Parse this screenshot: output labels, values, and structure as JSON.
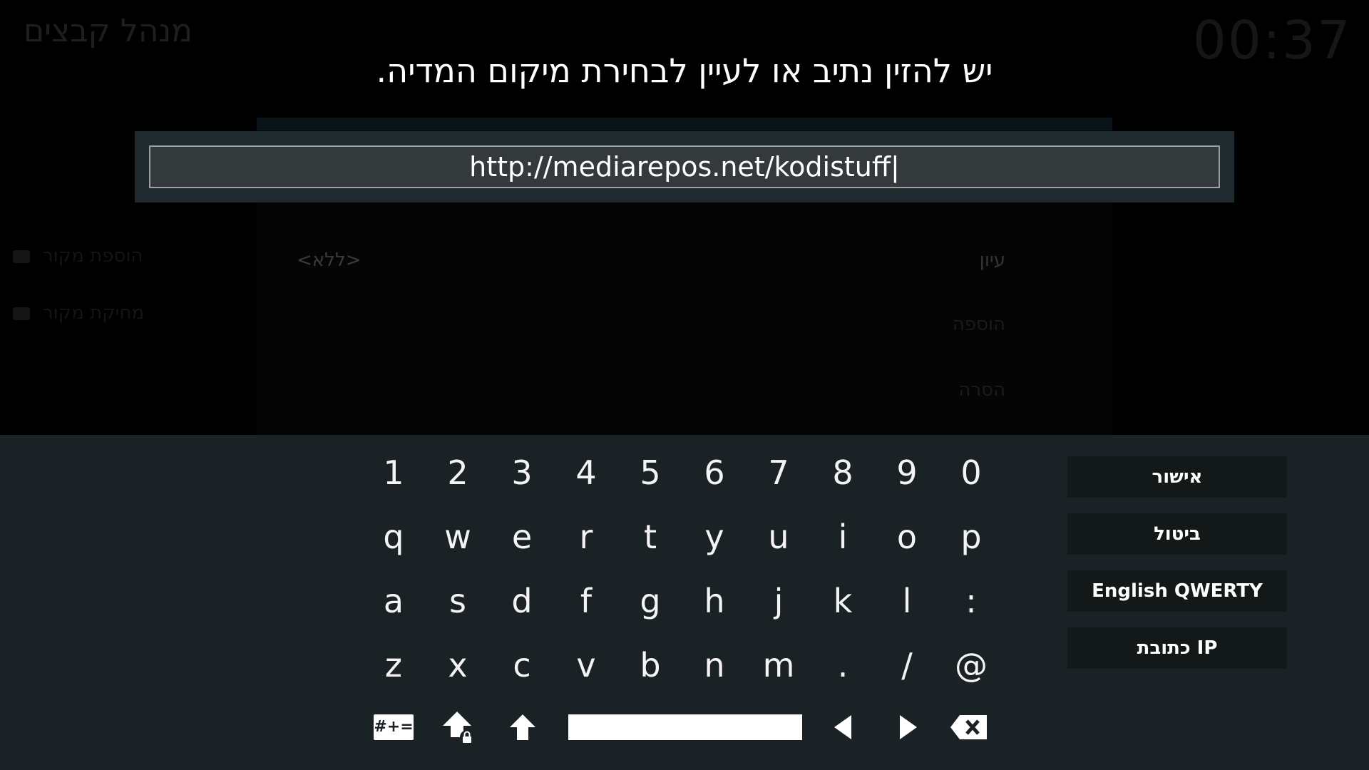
{
  "background": {
    "window_title": "מנהל קבצים",
    "clock": "00:37",
    "sidebar": [
      "הוספת מקור",
      "מחיקת מקור"
    ],
    "dialog": {
      "path_value": "<ללא>",
      "buttons": [
        "עיון",
        "הוספה",
        "הסרה"
      ]
    }
  },
  "prompt": {
    "heading": "יש להזין נתיב או לעיין לבחירת מיקום המדיה.",
    "input_value": "http://mediarepos.net/kodistuff|"
  },
  "keyboard": {
    "rows": [
      [
        "1",
        "2",
        "3",
        "4",
        "5",
        "6",
        "7",
        "8",
        "9",
        "0"
      ],
      [
        "q",
        "w",
        "e",
        "r",
        "t",
        "y",
        "u",
        "i",
        "o",
        "p"
      ],
      [
        "a",
        "s",
        "d",
        "f",
        "g",
        "h",
        "j",
        "k",
        "l",
        ":"
      ],
      [
        "z",
        "x",
        "c",
        "v",
        "b",
        "n",
        "m",
        ".",
        "/",
        "@"
      ]
    ],
    "symbols_label": "#+=",
    "actions": {
      "ok": "אישור",
      "cancel": "ביטול",
      "layout": "English QWERTY",
      "ip_address": "כתובת IP"
    }
  },
  "colors": {
    "keyboard_bg": "#1b2225",
    "input_bg": "#34393b",
    "button_bg": "#131819"
  }
}
